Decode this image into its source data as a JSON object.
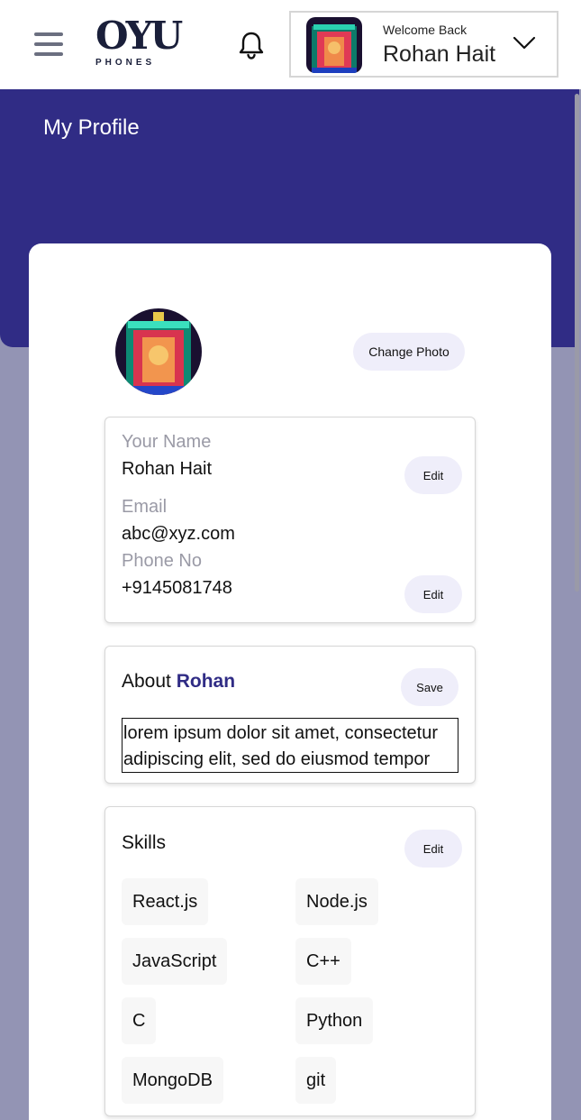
{
  "header": {
    "logo_top": "OYU",
    "logo_bottom": "PHONES",
    "welcome": "Welcome Back",
    "user_name": "Rohan Hait"
  },
  "page": {
    "title": "My Profile"
  },
  "profile": {
    "change_photo": "Change Photo",
    "name_label": "Your Name",
    "name_value": "Rohan Hait",
    "email_label": "Email",
    "email_value": "abc@xyz.com",
    "phone_label": "Phone No",
    "phone_value": "+9145081748",
    "edit_label": "Edit"
  },
  "about": {
    "prefix": "About",
    "name": "Rohan",
    "save_label": "Save",
    "text_line1": "lorem ipsum dolor sit amet, consectetur",
    "text_line2": "adipiscing elit, sed do eiusmod tempor"
  },
  "skills": {
    "title": "Skills",
    "edit_label": "Edit",
    "items": [
      "React.js",
      "Node.js",
      "JavaScript",
      "C++",
      "C",
      "Python",
      "MongoDB",
      "git"
    ]
  },
  "colors": {
    "accent": "#302c85",
    "background": "#9394b4",
    "pill": "#efeefa"
  },
  "icons": [
    "menu-icon",
    "bell-icon",
    "chevron-down-icon"
  ]
}
